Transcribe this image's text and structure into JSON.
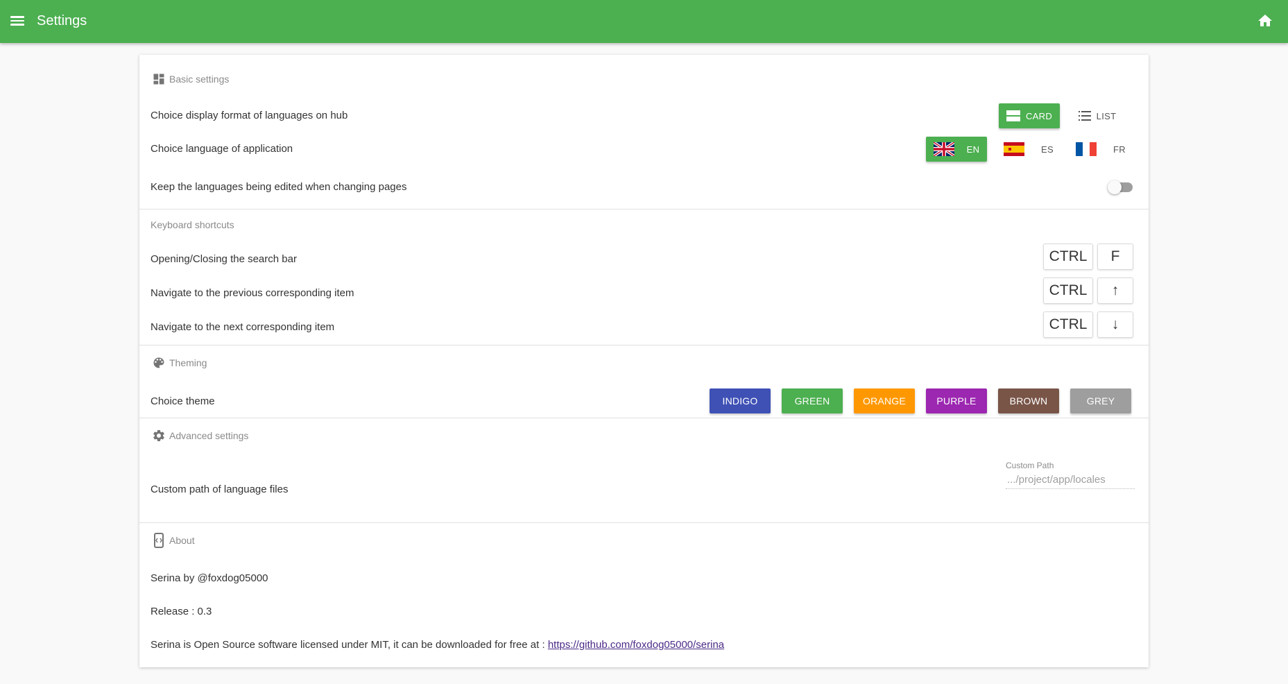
{
  "app": {
    "title": "Settings"
  },
  "colors": {
    "primary": "#4caf50"
  },
  "icons": {
    "menu": "menu-icon",
    "home": "home-icon",
    "basic": "dashboard-icon",
    "theming": "palette-icon",
    "advanced": "gear-icon",
    "about": "about-icon"
  },
  "basic": {
    "heading": "Basic settings",
    "display_label": "Choice display format of languages on hub",
    "display_options": [
      "CARD",
      "LIST"
    ],
    "display_selected": "CARD",
    "language_label": "Choice language of application",
    "language_options": [
      "EN",
      "ES",
      "FR"
    ],
    "language_selected": "EN",
    "keep_label": "Keep the languages being edited when changing pages",
    "keep_enabled": false
  },
  "shortcuts": {
    "heading": "Keyboard shortcuts",
    "items": [
      {
        "label": "Opening/Closing the search bar",
        "keys": [
          "CTRL",
          "F"
        ]
      },
      {
        "label": "Navigate to the previous corresponding item",
        "keys": [
          "CTRL",
          "↑"
        ]
      },
      {
        "label": "Navigate to the next corresponding item",
        "keys": [
          "CTRL",
          "↓"
        ]
      }
    ]
  },
  "theming": {
    "heading": "Theming",
    "label": "Choice theme",
    "themes": [
      {
        "name": "INDIGO",
        "color": "#3f51b5"
      },
      {
        "name": "GREEN",
        "color": "#4caf50"
      },
      {
        "name": "ORANGE",
        "color": "#ff9800"
      },
      {
        "name": "PURPLE",
        "color": "#9c27b0"
      },
      {
        "name": "BROWN",
        "color": "#795548"
      },
      {
        "name": "GREY",
        "color": "#9e9e9e"
      }
    ]
  },
  "advanced": {
    "heading": "Advanced settings",
    "path_label": "Custom path of language files",
    "field_label": "Custom Path",
    "field_placeholder": ".../project/app/locales",
    "field_value": ""
  },
  "about": {
    "heading": "About",
    "author": "Serina by @foxdog05000",
    "release": "Release : 0.3",
    "license_text": "Serina is Open Source software licensed under MIT, it can be downloaded for free at : ",
    "link": "https://github.com/foxdog05000/serina"
  }
}
